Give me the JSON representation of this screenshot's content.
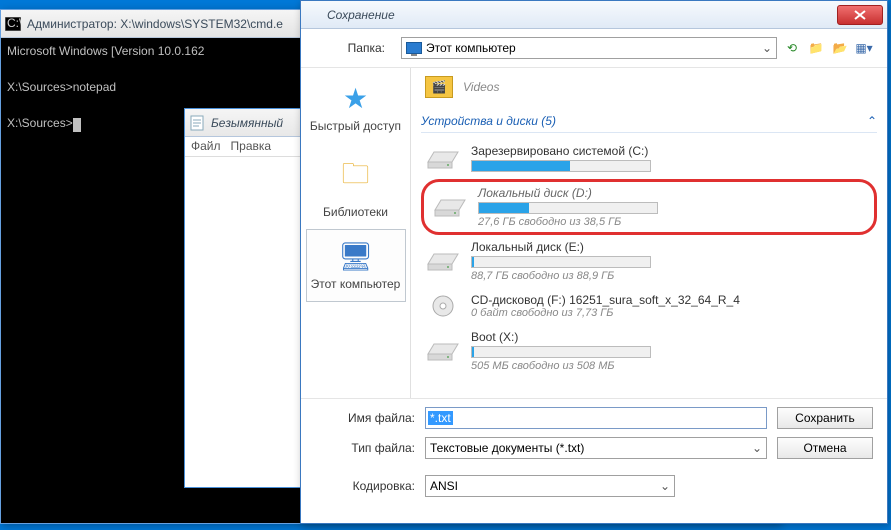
{
  "cmd": {
    "title": "Администратор: X:\\windows\\SYSTEM32\\cmd.e",
    "lines": "Microsoft Windows [Version 10.0.162\n\nX:\\Sources>notepad\n\nX:\\Sources>"
  },
  "notepad": {
    "title": "Безымянный",
    "menu": {
      "file": "Файл",
      "edit": "Правка"
    }
  },
  "save": {
    "title": "Сохранение",
    "folder_label": "Папка:",
    "folder_value": "Этот компьютер",
    "places": {
      "quick": "Быстрый доступ",
      "libs": "Библиотеки",
      "pc": "Этот компьютер"
    },
    "videos": "Videos",
    "section": "Устройства и диски (5)",
    "drives": [
      {
        "name": "Зарезервировано системой (C:)",
        "sub": "",
        "fill": 55
      },
      {
        "name": "Локальный диск (D:)",
        "sub": "27,6 ГБ свободно из 38,5 ГБ",
        "fill": 28,
        "hl": true
      },
      {
        "name": "Локальный диск (E:)",
        "sub": "88,7 ГБ свободно из 88,9 ГБ",
        "fill": 1
      },
      {
        "name": "CD-дисковод (F:) 16251_sura_soft_x_32_64_R_4",
        "sub": "0 байт свободно из 7,73 ГБ",
        "fill": 0,
        "cd": true
      },
      {
        "name": "Boot (X:)",
        "sub": "505 МБ свободно из 508 МБ",
        "fill": 1
      }
    ],
    "filename_label": "Имя файла:",
    "filename_value": "*.txt",
    "filetype_label": "Тип файла:",
    "filetype_value": "Текстовые документы (*.txt)",
    "encoding_label": "Кодировка:",
    "encoding_value": "ANSI",
    "save_btn": "Сохранить",
    "cancel_btn": "Отмена"
  }
}
